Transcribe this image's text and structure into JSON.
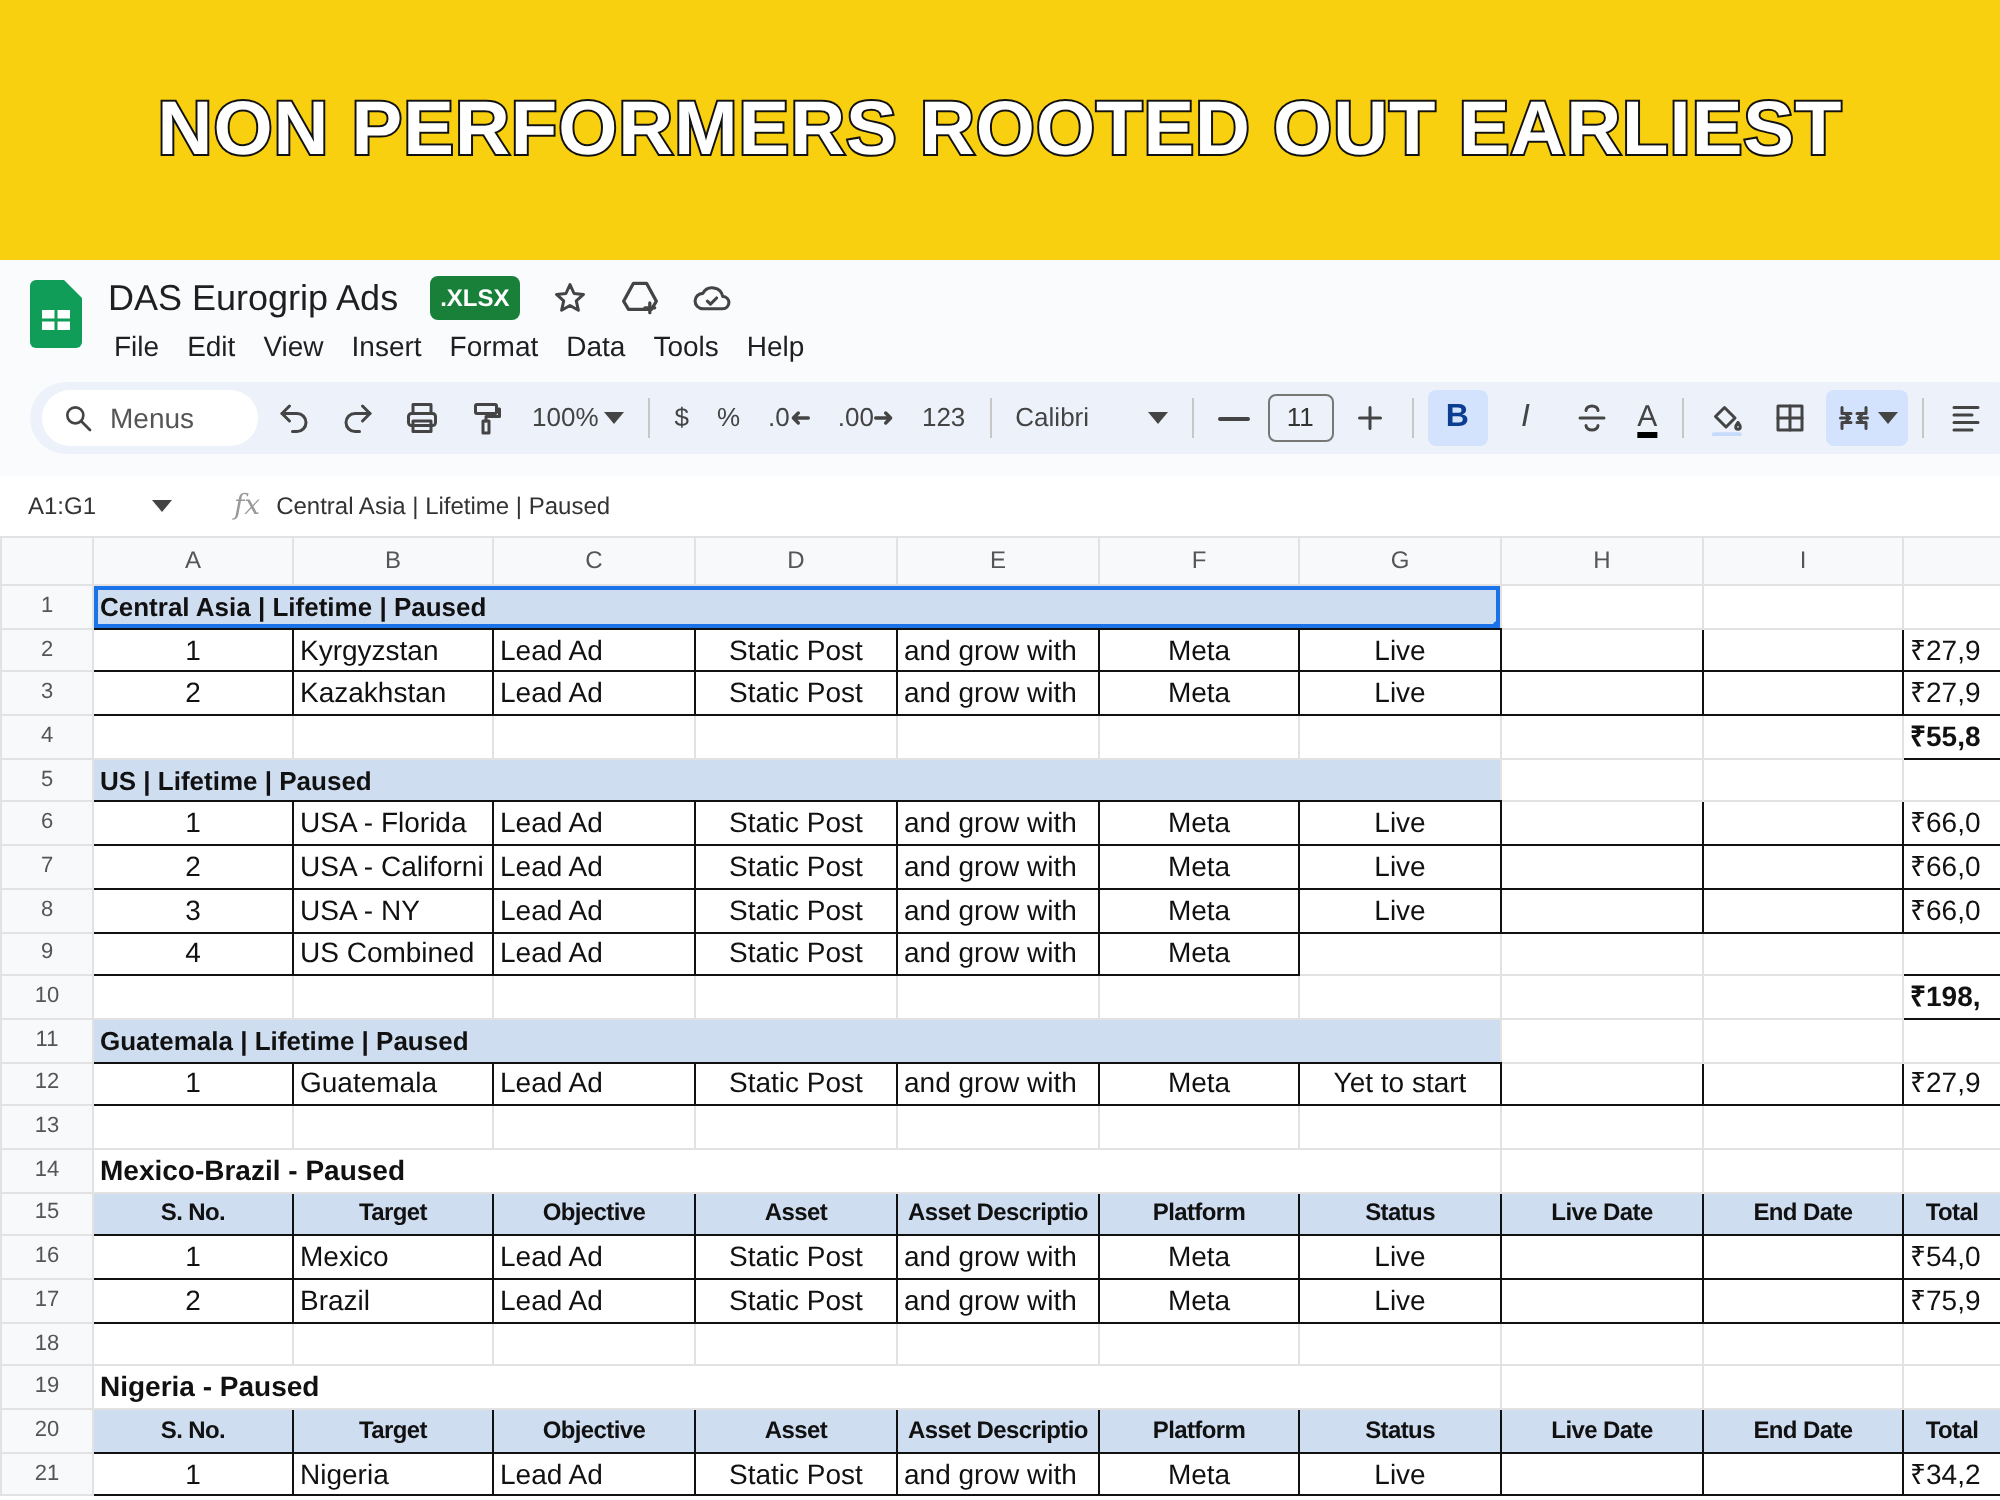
{
  "banner": {
    "title": "NON PERFORMERS ROOTED OUT EARLIEST"
  },
  "document": {
    "title": "DAS Eurogrip Ads",
    "badge": ".XLSX"
  },
  "menu": [
    "File",
    "Edit",
    "View",
    "Insert",
    "Format",
    "Data",
    "Tools",
    "Help"
  ],
  "toolbar": [
    {
      "kind": "search",
      "placeholder": "Menus"
    },
    {
      "kind": "undo"
    },
    {
      "kind": "redo"
    },
    {
      "kind": "print"
    },
    {
      "kind": "paint"
    },
    {
      "kind": "zoom",
      "text": "100%"
    },
    {
      "kind": "divider"
    },
    {
      "kind": "text",
      "text": "$"
    },
    {
      "kind": "text",
      "text": "%"
    },
    {
      "kind": "decless",
      "text": ".0"
    },
    {
      "kind": "decmore",
      "text": ".00"
    },
    {
      "kind": "text",
      "text": "123"
    },
    {
      "kind": "divider"
    },
    {
      "kind": "font",
      "text": "Calibri"
    },
    {
      "kind": "divider"
    },
    {
      "kind": "minus"
    },
    {
      "kind": "size",
      "text": "11"
    },
    {
      "kind": "plus"
    },
    {
      "kind": "divider"
    },
    {
      "kind": "bold",
      "text": "B",
      "on": true
    },
    {
      "kind": "italic",
      "text": "I",
      "on": false
    },
    {
      "kind": "strike"
    },
    {
      "kind": "color",
      "text": "A"
    },
    {
      "kind": "divider"
    },
    {
      "kind": "fill"
    },
    {
      "kind": "borders"
    },
    {
      "kind": "merge",
      "on": true
    },
    {
      "kind": "divider"
    },
    {
      "kind": "align"
    }
  ],
  "formula_bar": {
    "cell_range": "A1:G1",
    "function_label": "fx",
    "formula": "Central Asia | Lifetime | Paused"
  },
  "columns": [
    "A",
    "B",
    "C",
    "D",
    "E",
    "F",
    "G",
    "H",
    "I"
  ],
  "rows": [
    {
      "number": "1",
      "kind": "section",
      "title": "Central Asia | Lifetime | Paused",
      "selected": true
    },
    {
      "number": "2",
      "kind": "data",
      "cells": {
        "A": "1",
        "B": "Kyrgyzstan",
        "C": "Lead Ad",
        "D": "Static Post",
        "E": "and grow with",
        "F": "Meta",
        "G": "Live",
        "J": "₹27,9"
      }
    },
    {
      "number": "3",
      "kind": "data",
      "cells": {
        "A": "2",
        "B": "Kazakhstan",
        "C": "Lead Ad",
        "D": "Static Post",
        "E": "and grow with",
        "F": "Meta",
        "G": "Live",
        "J": "₹27,9"
      }
    },
    {
      "number": "4",
      "kind": "total",
      "value": "₹55,8"
    },
    {
      "number": "5",
      "kind": "section",
      "title": "US | Lifetime | Paused",
      "selected": false
    },
    {
      "number": "6",
      "kind": "data",
      "cells": {
        "A": "1",
        "B": "USA - Florida",
        "C": "Lead Ad",
        "D": "Static Post",
        "E": "and grow with",
        "F": "Meta",
        "G": "Live",
        "J": "₹66,0"
      }
    },
    {
      "number": "7",
      "kind": "data",
      "cells": {
        "A": "2",
        "B": "USA - Californi",
        "C": "Lead Ad",
        "D": "Static Post",
        "E": "and grow with",
        "F": "Meta",
        "G": "Live",
        "J": "₹66,0"
      }
    },
    {
      "number": "8",
      "kind": "data",
      "cells": {
        "A": "3",
        "B": "USA - NY",
        "C": "Lead Ad",
        "D": "Static Post",
        "E": "and grow with",
        "F": "Meta",
        "G": "Live",
        "J": "₹66,0"
      }
    },
    {
      "number": "9",
      "kind": "data",
      "cells": {
        "A": "4",
        "B": "US Combined",
        "C": "Lead Ad",
        "D": "Static Post",
        "E": "and grow with",
        "F": "Meta"
      }
    },
    {
      "number": "10",
      "kind": "total",
      "value": "₹198,"
    },
    {
      "number": "11",
      "kind": "section",
      "title": "Guatemala | Lifetime | Paused",
      "selected": false
    },
    {
      "number": "12",
      "kind": "data",
      "cells": {
        "A": "1",
        "B": "Guatemala",
        "C": "Lead Ad",
        "D": "Static Post",
        "E": "and grow with",
        "F": "Meta",
        "G": "Yet to start",
        "J": "₹27,9"
      }
    },
    {
      "number": "13",
      "kind": "empty"
    },
    {
      "number": "14",
      "kind": "heading",
      "title": "Mexico-Brazil - Paused"
    },
    {
      "number": "15",
      "kind": "header",
      "cells": {
        "A": "S. No.",
        "B": "Target",
        "C": "Objective",
        "D": "Asset",
        "E": "Asset Descriptio",
        "F": "Platform",
        "G": "Status",
        "H": "Live Date",
        "I": "End Date",
        "J": "Total"
      }
    },
    {
      "number": "16",
      "kind": "data",
      "cells": {
        "A": "1",
        "B": "Mexico",
        "C": "Lead Ad",
        "D": "Static Post",
        "E": "and grow with",
        "F": "Meta",
        "G": "Live",
        "J": "₹54,0"
      }
    },
    {
      "number": "17",
      "kind": "data",
      "cells": {
        "A": "2",
        "B": "Brazil",
        "C": "Lead Ad",
        "D": "Static Post",
        "E": "and grow with",
        "F": "Meta",
        "G": "Live",
        "J": "₹75,9"
      }
    },
    {
      "number": "18",
      "kind": "empty"
    },
    {
      "number": "19",
      "kind": "heading",
      "title": "Nigeria - Paused"
    },
    {
      "number": "20",
      "kind": "header",
      "cells": {
        "A": "S. No.",
        "B": "Target",
        "C": "Objective",
        "D": "Asset",
        "E": "Asset Descriptio",
        "F": "Platform",
        "G": "Status",
        "H": "Live Date",
        "I": "End Date",
        "J": "Total"
      }
    },
    {
      "number": "21",
      "kind": "data",
      "cells": {
        "A": "1",
        "B": "Nigeria",
        "C": "Lead Ad",
        "D": "Static Post",
        "E": "and grow with",
        "F": "Meta",
        "G": "Live",
        "J": "₹34,2"
      }
    }
  ]
}
